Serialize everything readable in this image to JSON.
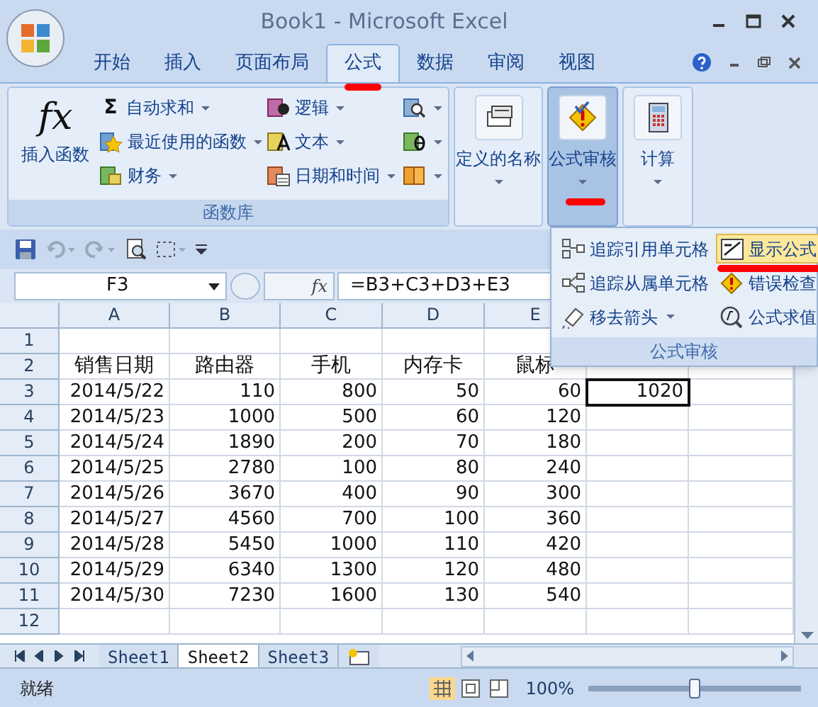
{
  "window": {
    "title": "Book1 - Microsoft Excel"
  },
  "ribbon_tabs": [
    {
      "label": "开始",
      "selected": false,
      "underlined": false
    },
    {
      "label": "插入",
      "selected": false,
      "underlined": false
    },
    {
      "label": "页面布局",
      "selected": false,
      "underlined": false
    },
    {
      "label": "公式",
      "selected": true,
      "underlined": true
    },
    {
      "label": "数据",
      "selected": false,
      "underlined": false
    },
    {
      "label": "审阅",
      "selected": false,
      "underlined": false
    },
    {
      "label": "视图",
      "selected": false,
      "underlined": false
    }
  ],
  "function_library": {
    "insert_function": {
      "icon": "fx",
      "label": "插入函数"
    },
    "columns": [
      [
        {
          "label": "自动求和",
          "icon": "Σ",
          "kind": "sigma"
        },
        {
          "label": "最近使用的函数",
          "kind": "star"
        },
        {
          "label": "财务",
          "kind": "money"
        }
      ],
      [
        {
          "label": "逻辑",
          "kind": "logic"
        },
        {
          "label": "文本",
          "kind": "text"
        },
        {
          "label": "日期和时间",
          "kind": "date"
        }
      ],
      [
        {
          "kind": "lookup"
        },
        {
          "kind": "math"
        },
        {
          "kind": "more"
        }
      ]
    ],
    "label": "函数库"
  },
  "big_buttons": [
    {
      "label": "定义的名称",
      "selected": false,
      "underlined": false,
      "kind": "names"
    },
    {
      "label": "公式审核",
      "selected": true,
      "underlined": true,
      "kind": "audit"
    },
    {
      "label": "计算",
      "selected": false,
      "underlined": false,
      "kind": "calc"
    }
  ],
  "audit_menu": {
    "items": [
      {
        "label": "追踪引用单元格",
        "kind": "precedents",
        "selected": false,
        "underlined": false
      },
      {
        "label": "显示公式",
        "kind": "show",
        "selected": true,
        "underlined": true
      },
      {
        "label": "追踪从属单元格",
        "kind": "dependents",
        "selected": false,
        "underlined": false
      },
      {
        "label": "错误检查",
        "kind": "error",
        "selected": false,
        "underlined": false
      },
      {
        "label": "移去箭头",
        "kind": "remove",
        "selected": false,
        "underlined": false,
        "dropdown": true
      },
      {
        "label": "公式求值",
        "kind": "evaluate",
        "selected": false,
        "underlined": false
      }
    ],
    "label": "公式审核"
  },
  "name_box": "F3",
  "fx": "fx",
  "formula": "=B3+C3+D3+E3",
  "columns": [
    "A",
    "B",
    "C",
    "D",
    "E"
  ],
  "rows": [
    {
      "number": "1",
      "kind": "blank"
    },
    {
      "number": "2",
      "kind": "header",
      "cells": [
        {
          "text": "销售日期",
          "selected": false
        },
        {
          "text": "路由器",
          "selected": false
        },
        {
          "text": "手机",
          "selected": false
        },
        {
          "text": "内存卡",
          "selected": false
        },
        {
          "text": "鼠标",
          "selected": false
        }
      ]
    },
    {
      "number": "3",
      "kind": "data",
      "cells": [
        {
          "text": "2014/5/22",
          "selected": false
        },
        {
          "text": "110",
          "selected": false
        },
        {
          "text": "800",
          "selected": false
        },
        {
          "text": "50",
          "selected": false
        },
        {
          "text": "60",
          "selected": false
        },
        {
          "text": "1020",
          "selected": true
        }
      ]
    },
    {
      "number": "4",
      "kind": "data",
      "cells": [
        {
          "text": "2014/5/23",
          "selected": false
        },
        {
          "text": "1000",
          "selected": false
        },
        {
          "text": "500",
          "selected": false
        },
        {
          "text": "60",
          "selected": false
        },
        {
          "text": "120",
          "selected": false
        }
      ]
    },
    {
      "number": "5",
      "kind": "data",
      "cells": [
        {
          "text": "2014/5/24",
          "selected": false
        },
        {
          "text": "1890",
          "selected": false
        },
        {
          "text": "200",
          "selected": false
        },
        {
          "text": "70",
          "selected": false
        },
        {
          "text": "180",
          "selected": false
        }
      ]
    },
    {
      "number": "6",
      "kind": "data",
      "cells": [
        {
          "text": "2014/5/25",
          "selected": false
        },
        {
          "text": "2780",
          "selected": false
        },
        {
          "text": "100",
          "selected": false
        },
        {
          "text": "80",
          "selected": false
        },
        {
          "text": "240",
          "selected": false
        }
      ]
    },
    {
      "number": "7",
      "kind": "data",
      "cells": [
        {
          "text": "2014/5/26",
          "selected": false
        },
        {
          "text": "3670",
          "selected": false
        },
        {
          "text": "400",
          "selected": false
        },
        {
          "text": "90",
          "selected": false
        },
        {
          "text": "300",
          "selected": false
        }
      ]
    },
    {
      "number": "8",
      "kind": "data",
      "cells": [
        {
          "text": "2014/5/27",
          "selected": false
        },
        {
          "text": "4560",
          "selected": false
        },
        {
          "text": "700",
          "selected": false
        },
        {
          "text": "100",
          "selected": false
        },
        {
          "text": "360",
          "selected": false
        }
      ]
    },
    {
      "number": "9",
      "kind": "data",
      "cells": [
        {
          "text": "2014/5/28",
          "selected": false
        },
        {
          "text": "5450",
          "selected": false
        },
        {
          "text": "1000",
          "selected": false
        },
        {
          "text": "110",
          "selected": false
        },
        {
          "text": "420",
          "selected": false
        }
      ]
    },
    {
      "number": "10",
      "kind": "data",
      "cells": [
        {
          "text": "2014/5/29",
          "selected": false
        },
        {
          "text": "6340",
          "selected": false
        },
        {
          "text": "1300",
          "selected": false
        },
        {
          "text": "120",
          "selected": false
        },
        {
          "text": "480",
          "selected": false
        }
      ]
    },
    {
      "number": "11",
      "kind": "data",
      "cells": [
        {
          "text": "2014/5/30",
          "selected": false
        },
        {
          "text": "7230",
          "selected": false
        },
        {
          "text": "1600",
          "selected": false
        },
        {
          "text": "130",
          "selected": false
        },
        {
          "text": "540",
          "selected": false
        }
      ]
    },
    {
      "number": "12",
      "kind": "blank"
    }
  ],
  "sheet_tabs": [
    {
      "label": "Sheet1",
      "selected": false
    },
    {
      "label": "Sheet2",
      "selected": true
    },
    {
      "label": "Sheet3",
      "selected": false
    }
  ],
  "status_bar": {
    "text": "就绪",
    "zoom": "100%",
    "zoom_slider": {
      "level": 0.5
    }
  }
}
